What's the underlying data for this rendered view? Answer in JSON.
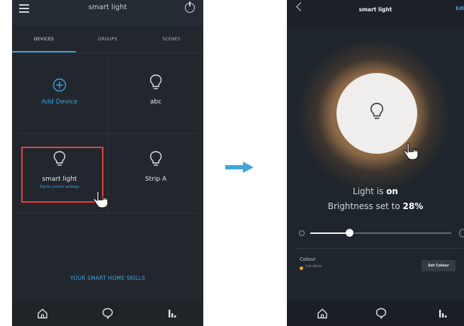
{
  "left_screen": {
    "title": "smart light",
    "tabs": [
      "DEVICES",
      "GROUPS",
      "SCENES"
    ],
    "tiles": [
      {
        "label": "Add Device",
        "icon": "add-circle-icon"
      },
      {
        "label": "abc",
        "icon": "bulb-icon"
      },
      {
        "label": "smart light",
        "sub": "Tap to control settings",
        "icon": "bulb-icon"
      },
      {
        "label": "Strip A",
        "icon": "bulb-icon"
      }
    ],
    "skills_link": "YOUR SMART HOME SKILLS",
    "nav_icons": [
      "home-icon",
      "chat-icon",
      "stats-icon"
    ]
  },
  "right_screen": {
    "title": "smart light",
    "edit_label": "Edit",
    "status_prefix": "Light is ",
    "status_value": "on",
    "brightness_prefix": "Brightness set to ",
    "brightness_value": "28%",
    "brightness_level": 0.28,
    "colour_label": "Colour",
    "colour_value": "Soft White",
    "set_colour_label": "Set Colour",
    "nav_icons": [
      "home-icon",
      "chat-icon",
      "stats-icon"
    ]
  },
  "colors": {
    "accent": "#3aa3e3",
    "highlight": "#e8413a",
    "glow": "#e9a35c",
    "swatch": "#f0a03c"
  }
}
